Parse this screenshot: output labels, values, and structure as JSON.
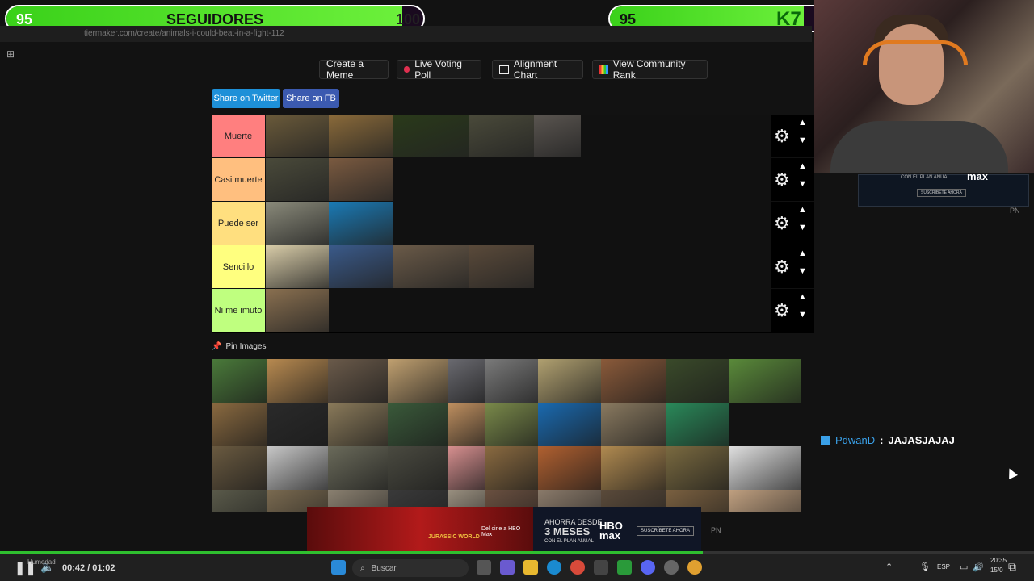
{
  "overlay": {
    "left_meter": {
      "value": "95",
      "label": "SEGUIDORES",
      "max": "100",
      "fill_fraction": 0.95
    },
    "right_meter": {
      "value": "95",
      "badge": "K7",
      "fill_fraction": 0.95
    }
  },
  "browser": {
    "url": "tiermaker.com/create/animals-i-could-beat-in-a-fight-112"
  },
  "toolbar": {
    "buttons": [
      "Create a Meme",
      "Live Voting Poll",
      "Alignment Chart",
      "View Community Rank"
    ]
  },
  "share": {
    "twitter": "Share on Twitter",
    "fb": "Share on FB"
  },
  "tiers": [
    {
      "label": "Muerte",
      "color": "#ff7f7f",
      "tiles": [
        "#6a5a3a",
        "#8a6a3a",
        "#2a3a1a",
        "#4a4a3a",
        "#5a5550"
      ]
    },
    {
      "label": "Casi muerte",
      "color": "#ffbf7f",
      "tiles": [
        "#4a4a3a",
        "#7a5a40"
      ]
    },
    {
      "label": "Puede ser",
      "color": "#ffdf7f",
      "tiles": [
        "#8a8a7a",
        "#1a7ab5"
      ]
    },
    {
      "label": "Sencillo",
      "color": "#ffff7f",
      "tiles": [
        "#d8cca8",
        "#3a5a8a",
        "#6a5a48",
        "#5a4a3a"
      ]
    },
    {
      "label": "Ni me imuto",
      "color": "#bfff7f",
      "tiles": [
        "#8a7050"
      ]
    }
  ],
  "pin": {
    "label": "Pin Images"
  },
  "pool": [
    [
      "#4a7a3a",
      "#b88a50",
      "#6a5a4a",
      "#c0a070",
      "#6a6a70",
      "#7a7a7a",
      "#b0a070",
      "#8a5a3a",
      "#3a4a2a",
      "#5a8a3a"
    ],
    [
      "#8a6a40",
      "#2a2a2a",
      "#8a7a5a",
      "#3a5a3a",
      "#c09060",
      "#7a8a4a",
      "#1a6ab0",
      "#8a7a60",
      "#2a8a5a"
    ],
    [
      "#6a5a40",
      "#c8c8c8",
      "#6a6a5a",
      "#4a4a40",
      "#d89090",
      "#8a6a40",
      "#b06030",
      "#b08a50",
      "#7a6a40",
      "#e0e0e0"
    ],
    [
      "#5a5a4a",
      "#7a6a50",
      "#8a8070",
      "#3a3a3a",
      "#9a9080",
      "#6a5040",
      "#8a7a6a",
      "#5a4a3a",
      "#7a6040",
      "#c0a080"
    ]
  ],
  "chat": {
    "user": "PdwanD",
    "separator": ":",
    "message": "JAJASJAJAJ"
  },
  "ads": {
    "right_line1": "CON EL PLAN ANUAL",
    "right_brand": "max",
    "right_cta": "SUSCRÍBETE AHORA",
    "right_tag": "PN",
    "bottom_brand": "JURASSIC WORLD",
    "bottom_line1": "Del cine a HBO Max",
    "bottom_offer1": "AHORRA DESDE",
    "bottom_offer2": "3 MESES",
    "bottom_offer3": "CON EL PLAN ANUAL",
    "bottom_hbo": "HBO max",
    "bottom_cta": "SUSCRÍBETE AHORA",
    "bottom_tag": "PN"
  },
  "player": {
    "time": "00:42 / 01:02",
    "progress_fraction": 0.68,
    "weather": "Humedad"
  },
  "taskbar": {
    "search_placeholder": "Buscar",
    "lang": "ESP",
    "clock": "20:35",
    "date": "15/0"
  }
}
